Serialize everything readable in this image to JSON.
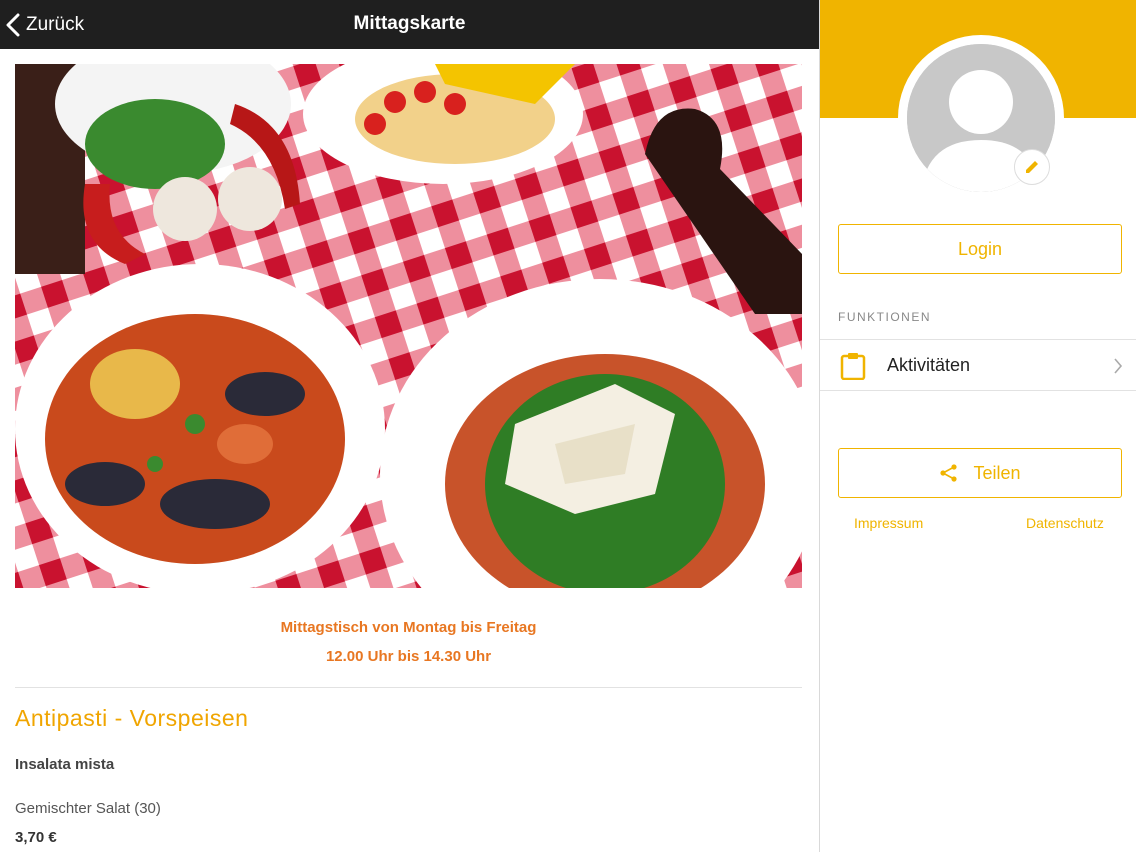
{
  "header": {
    "back_label": "Zurück",
    "title": "Mittagskarte"
  },
  "hero": {
    "image": "food-photo"
  },
  "info": {
    "line1": "Mittagstisch von Montag bis Freitag",
    "line2": "12.00 Uhr bis 14.30 Uhr"
  },
  "menu": {
    "section_title": "Antipasti - Vorspeisen",
    "item": {
      "name": "Insalata mista",
      "description": "Gemischter Salat (30)",
      "price": "3,70 €"
    }
  },
  "sidebar": {
    "login_label": "Login",
    "section_label": "FUNKTIONEN",
    "activities_label": "Aktivitäten",
    "share_label": "Teilen",
    "impressum_label": "Impressum",
    "privacy_label": "Datenschutz"
  },
  "colors": {
    "accent": "#f0b400",
    "info_text": "#e87722",
    "topbar": "#1f1f1f"
  }
}
